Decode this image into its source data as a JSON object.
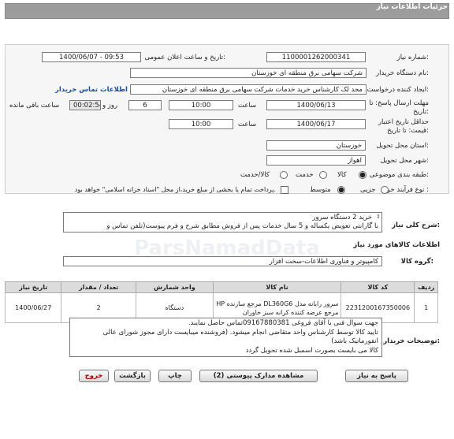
{
  "header": {
    "title": "جزئیات اطلاعات نیاز"
  },
  "form": {
    "need_number_label": "شماره نیاز:",
    "need_number": "1100001262000341",
    "announce_label": "تاریخ و ساعت اعلان عمومی:",
    "announce_value": "1400/06/07 - 09:53",
    "buyer_label": "نام دستگاه خریدار:",
    "buyer_value": "شرکت سهامی برق منطقه ای خوزستان",
    "creator_label": "ایجاد کننده درخواست:",
    "creator_value": "مجد لک کارشناس خرید خدمات شرکت سهامی برق منطقه ای خوزستان",
    "contact_link": "اطلاعات تماس خریدار",
    "deadline_label_1": "مهلت ارسال پاسخ: تا",
    "deadline_label_2": "تاریخ:",
    "deadline_date": "1400/06/13",
    "time_label": "ساعت",
    "deadline_time": "10:00",
    "days_value": "6",
    "days_label": "روز و",
    "remaining_time": "00:02:54",
    "remaining_label": "ساعت باقی مانده",
    "validity_label_1": "حداقل تاریخ اعتبار",
    "validity_label_2": "قیمت: تا تاریخ:",
    "validity_date": "1400/06/17",
    "validity_time_label": "ساعت",
    "validity_time": "10:00",
    "province_label": "استان محل تحویل:",
    "province_value": "خوزستان",
    "city_label": "شهر محل تحویل:",
    "city_value": "اهواز",
    "category_label": "طبقه بندی موضوعی:",
    "category_options": [
      "کالا",
      "خدمت",
      "کالا/خدمت"
    ],
    "category_selected": "کالا",
    "process_label": "نوع فرآیند خرید :",
    "process_options": [
      "جزیی",
      "متوسط"
    ],
    "process_selected": "متوسط",
    "payment_text": "پرداخت تمام یا بخشی از مبلغ خرید،از محل \"اسناد خزانه اسلامی\" خواهد بود."
  },
  "summary": {
    "label": "شرح کلی نیاز:",
    "line1": "خرید 2 دستگاه سرور",
    "line2": "با گارانتی تعویض یکساله و 5 سال خدمات پس از فروش مطابق شرح و فرم پیوست(تلفن تماس و"
  },
  "goods_section": {
    "title": "اطلاعات کالاهای مورد نیاز",
    "group_label": "گروه کالا:",
    "group_value": "کامپیوتر و فناوری اطلاعات-سخت افزار"
  },
  "table": {
    "headers": [
      "ردیف",
      "کد کالا",
      "نام کالا",
      "واحد شمارش",
      "تعداد / مقدار",
      "تاریخ نیاز"
    ],
    "rows": [
      {
        "index": "1",
        "code": "2231200167350006",
        "name": "سرور رایانه مدل DL360G6 مرجع سازنده HP مرجع عرضه کننده کرانه سبز خاوران",
        "unit": "دستگاه",
        "qty": "2",
        "date": "1400/06/27"
      }
    ]
  },
  "buyer_notes": {
    "label": "توضیحات خریدار:",
    "line1": "جهت سوال فنی با آقای فروغی 09167880381تماس حاصل نمایند.",
    "line2": "تایید کالا توسط کارشناس واحد متقاضی انجام میشود. (فروشنده میبایست دارای مجوز شورای عالی",
    "line3": "انفورماتیک باشد)",
    "line4": "کالا می بایست بصورت اسمبل شده تحویل گردد"
  },
  "buttons": {
    "reply": "پاسخ به نیاز",
    "attachments": "مشاهده مدارک پیوستی (2)",
    "print": "چاپ",
    "back": "بازگشت",
    "exit": "خروج"
  },
  "colors": {
    "header": "#9c9c9c",
    "exit_text": "#b00000",
    "link": "#1a4fa0"
  }
}
